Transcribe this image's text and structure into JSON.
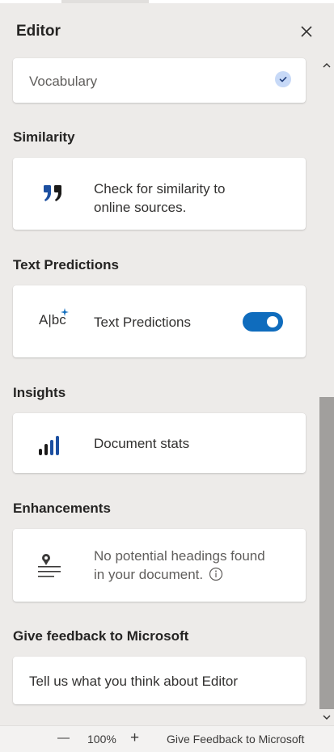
{
  "pane": {
    "title": "Editor"
  },
  "vocabulary": {
    "label": "Vocabulary"
  },
  "similarity": {
    "title": "Similarity",
    "text_line1": "Check for similarity to",
    "text_line2": "online sources."
  },
  "text_predictions": {
    "title": "Text Predictions",
    "icon_text": "A|bc",
    "label": "Text Predictions",
    "toggle_on": true
  },
  "insights": {
    "title": "Insights",
    "label": "Document stats"
  },
  "enhancements": {
    "title": "Enhancements",
    "text_line1": "No potential headings found",
    "text_line2": "in your document."
  },
  "feedback": {
    "title": "Give feedback to Microsoft",
    "label": "Tell us what you think about Editor"
  },
  "status_bar": {
    "zoom_out": "—",
    "zoom": "100%",
    "zoom_in": "+",
    "feedback": "Give Feedback to Microsoft"
  },
  "colors": {
    "accent": "#0f6cbd",
    "pane_bg": "#edebe9",
    "card_bg": "#ffffff"
  }
}
